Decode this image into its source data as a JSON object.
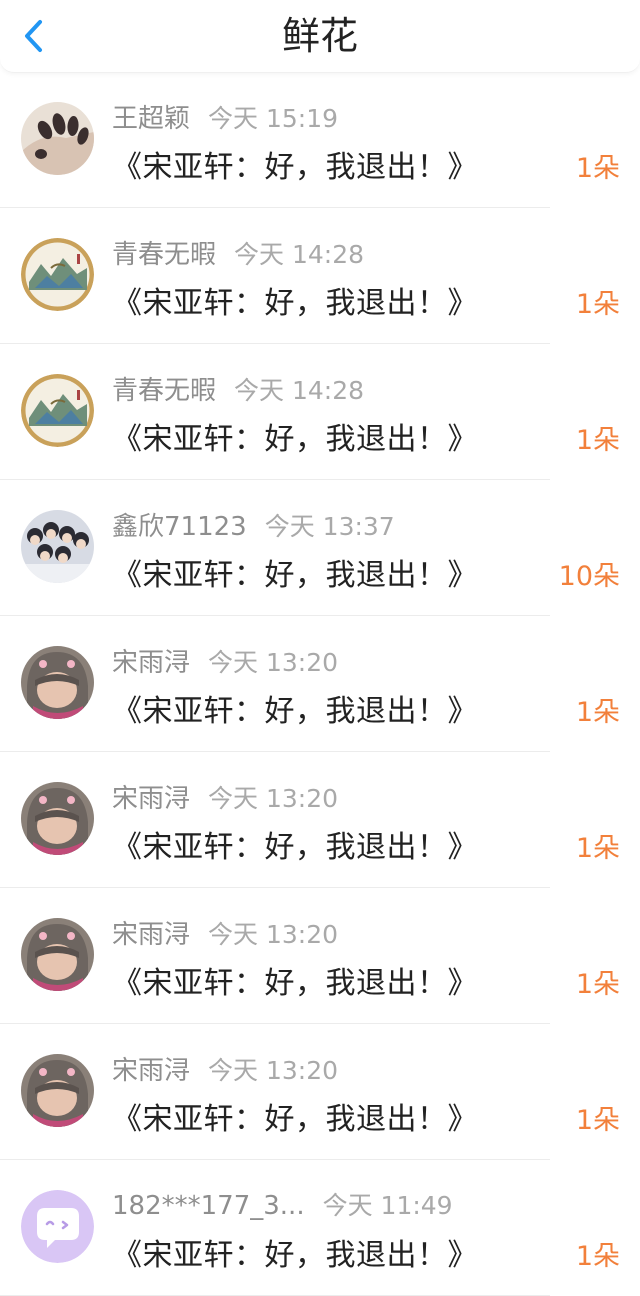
{
  "header": {
    "title": "鲜花",
    "back_icon": "chevron-left-icon",
    "accent": "#2196f3"
  },
  "colors": {
    "count": "#f2803b",
    "name": "#8e8e8e",
    "time": "#a9a9a9",
    "message": "#222222"
  },
  "rows": [
    {
      "avatar": "hand-nails-avatar",
      "name": "王超颖",
      "time": "今天 15:19",
      "message": "《宋亚轩：好，我退出！》",
      "count": "1朵"
    },
    {
      "avatar": "landscape-painting-avatar",
      "name": "青春无暇",
      "time": "今天 14:28",
      "message": "《宋亚轩：好，我退出！》",
      "count": "1朵"
    },
    {
      "avatar": "landscape-painting-avatar",
      "name": "青春无暇",
      "time": "今天 14:28",
      "message": "《宋亚轩：好，我退出！》",
      "count": "1朵"
    },
    {
      "avatar": "group-photo-avatar",
      "name": "鑫欣71123",
      "time": "今天 13:37",
      "message": "《宋亚轩：好，我退出！》",
      "count": "10朵"
    },
    {
      "avatar": "hooded-girl-avatar",
      "name": "宋雨浔",
      "time": "今天 13:20",
      "message": "《宋亚轩：好，我退出！》",
      "count": "1朵"
    },
    {
      "avatar": "hooded-girl-avatar",
      "name": "宋雨浔",
      "time": "今天 13:20",
      "message": "《宋亚轩：好，我退出！》",
      "count": "1朵"
    },
    {
      "avatar": "hooded-girl-avatar",
      "name": "宋雨浔",
      "time": "今天 13:20",
      "message": "《宋亚轩：好，我退出！》",
      "count": "1朵"
    },
    {
      "avatar": "hooded-girl-avatar",
      "name": "宋雨浔",
      "time": "今天 13:20",
      "message": "《宋亚轩：好，我退出！》",
      "count": "1朵"
    },
    {
      "avatar": "chat-bubble-avatar",
      "name": "182***177_3...",
      "time": "今天 11:49",
      "message": "《宋亚轩：好，我退出！》",
      "count": "1朵"
    }
  ]
}
